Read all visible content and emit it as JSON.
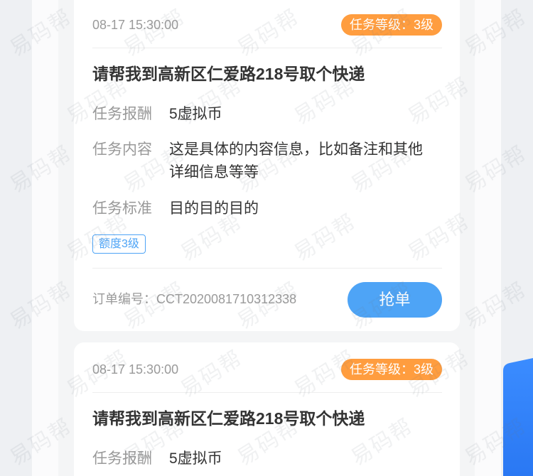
{
  "watermark": "易码帮",
  "colors": {
    "accent": "#4ea4f6",
    "badge": "#ff9d3f",
    "brand": "#2f7ff8"
  },
  "tasks": [
    {
      "time": "08-17 15:30:00",
      "level_badge": "任务等级：3级",
      "title": "请帮我到高新区仁爱路218号取个快递",
      "fields": [
        {
          "label": "任务报酬",
          "value": "5虚拟币"
        },
        {
          "label": "任务内容",
          "value": "这是具体的内容信息，比如备注和其他详细信息等等"
        },
        {
          "label": "任务标准",
          "value": "目的目的目的"
        }
      ],
      "quota_tag": "额度3级",
      "order_no": "订单编号：CCT2020081710312338",
      "grab_button": "抢单"
    },
    {
      "time": "08-17 15:30:00",
      "level_badge": "任务等级：3级",
      "title": "请帮我到高新区仁爱路218号取个快递",
      "fields": [
        {
          "label": "任务报酬",
          "value": "5虚拟币"
        }
      ]
    }
  ]
}
